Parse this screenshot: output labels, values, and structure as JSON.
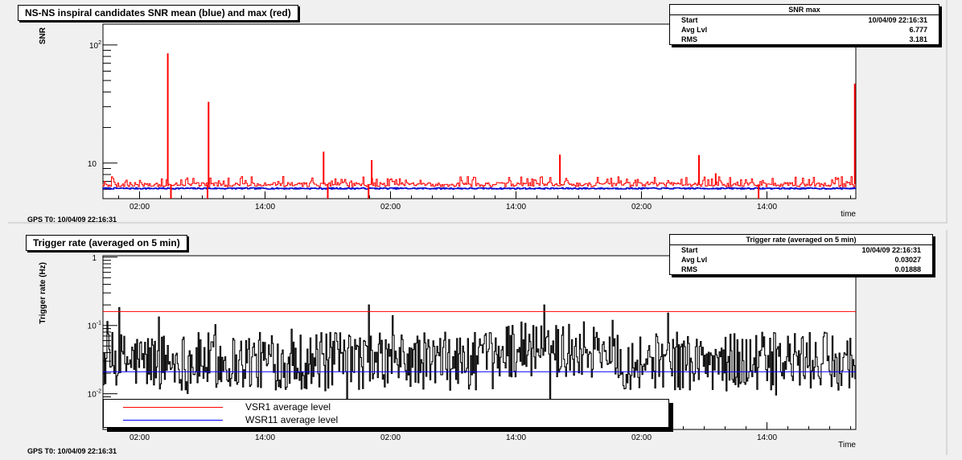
{
  "panels": {
    "top": {
      "title": "NS-NS inspiral candidates SNR mean (blue) and max (red)",
      "ylabel": "SNR",
      "xlabel": "time",
      "gps": "GPS T0: 10/04/09 22:16:31",
      "stats": {
        "title": "SNR max",
        "rows": [
          {
            "label": "Start",
            "value": "10/04/09 22:16:31"
          },
          {
            "label": "Avg Lvl",
            "value": "6.777"
          },
          {
            "label": "RMS",
            "value": "3.181"
          }
        ]
      }
    },
    "bottom": {
      "title": "Trigger rate (averaged on 5 min)",
      "ylabel": "Trigger rate (Hz)",
      "xlabel": "Time",
      "gps": "GPS T0: 10/04/09 22:16:31",
      "stats": {
        "title": "Trigger rate (averaged on 5 min)",
        "rows": [
          {
            "label": "Start",
            "value": "10/04/09 22:16:31"
          },
          {
            "label": "Avg Lvl",
            "value": "0.03027"
          },
          {
            "label": "RMS",
            "value": "0.01888"
          }
        ]
      },
      "legend": [
        {
          "label": "VSR1 average level",
          "color": "#ff0000"
        },
        {
          "label": "WSR11 average level",
          "color": "#0000ff"
        }
      ]
    }
  },
  "chart_data": [
    {
      "type": "line",
      "title": "NS-NS inspiral candidates SNR mean (blue) and max (red)",
      "xlabel": "time",
      "ylabel": "SNR",
      "yscale": "log",
      "ylim": [
        5,
        150
      ],
      "xlim_hours": [
        -1.5,
        70.5
      ],
      "x_ticks": [
        {
          "label": "02:00",
          "hours": 2
        },
        {
          "label": "14:00",
          "hours": 14
        },
        {
          "label": "02:00",
          "hours": 26
        },
        {
          "label": "14:00",
          "hours": 38
        },
        {
          "label": "02:00",
          "hours": 50
        },
        {
          "label": "14:00",
          "hours": 62
        }
      ],
      "y_ticks": [
        {
          "label": "10",
          "base": "10",
          "exp": "",
          "value": 10
        },
        {
          "label": "10^2",
          "base": "10",
          "exp": "2",
          "value": 100
        }
      ],
      "series": [
        {
          "color": "#ff0000",
          "baseline": 6.6,
          "spikes": [
            {
              "hours": 4.7,
              "value": 85
            },
            {
              "hours": 8.6,
              "value": 33
            },
            {
              "hours": 19.6,
              "value": 12.5
            },
            {
              "hours": 24.2,
              "value": 10.6
            },
            {
              "hours": 42.2,
              "value": 11.8
            },
            {
              "hours": 55.5,
              "value": 11.7
            },
            {
              "hours": 57.1,
              "value": 8.2
            },
            {
              "hours": 70.4,
              "value": 47
            },
            {
              "hours": 5.0,
              "value": 5.0
            },
            {
              "hours": 8.5,
              "value": 5.0
            },
            {
              "hours": 20.0,
              "value": 5.0
            },
            {
              "hours": 23.9,
              "value": 5.0
            },
            {
              "hours": 61.2,
              "value": 5.0
            }
          ]
        },
        {
          "color": "#0000cc",
          "baseline": 6.1,
          "spikes": []
        }
      ]
    },
    {
      "type": "line",
      "title": "Trigger rate (averaged on 5 min)",
      "xlabel": "Time",
      "ylabel": "Trigger rate (Hz)",
      "yscale": "log",
      "ylim": [
        0.003,
        1.05
      ],
      "xlim_hours": [
        -1.5,
        70.5
      ],
      "x_ticks": [
        {
          "label": "02:00",
          "hours": 2
        },
        {
          "label": "14:00",
          "hours": 14
        },
        {
          "label": "02:00",
          "hours": 26
        },
        {
          "label": "14:00",
          "hours": 38
        },
        {
          "label": "02:00",
          "hours": 50
        },
        {
          "label": "14:00",
          "hours": 62
        }
      ],
      "y_ticks": [
        {
          "label": "1",
          "base": "1",
          "exp": "",
          "value": 1
        },
        {
          "label": "10^-1",
          "base": "10",
          "exp": "-1",
          "value": 0.1
        },
        {
          "label": "10^-2",
          "base": "10",
          "exp": "-2",
          "value": 0.01
        }
      ],
      "series": [
        {
          "name": "VSR1 average level",
          "color": "#ff0000",
          "level": 0.16
        },
        {
          "name": "WSR11 average level",
          "color": "#0000ff",
          "level": 0.021
        },
        {
          "color": "#000000",
          "baseline": 0.03
        }
      ]
    }
  ]
}
